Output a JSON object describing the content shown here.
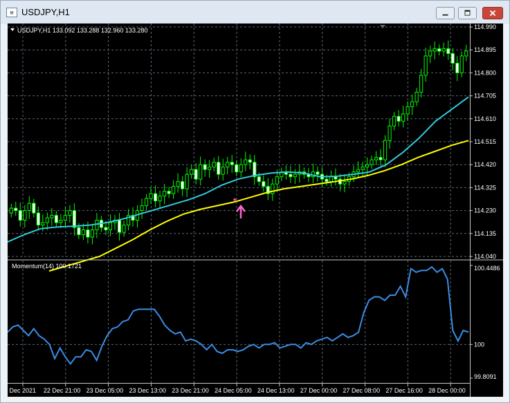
{
  "window": {
    "title": "USDJPY,H1",
    "icon": "chart-window-icon"
  },
  "window_controls": {
    "minimize_icon": "minimize-icon",
    "maximize_icon": "restore-icon",
    "close_icon": "close-icon"
  },
  "price_panel": {
    "header": "USDJPY,H1  133.092 133.288 132.960 133.280",
    "y_ticks": [
      "114.990",
      "114.895",
      "114.800",
      "114.705",
      "114.610",
      "114.515",
      "114.420",
      "114.325",
      "114.230",
      "114.135",
      "114.040"
    ]
  },
  "momentum_panel": {
    "header": "Momentum(14) 100.1721",
    "y_ticks": [
      "100.4486",
      "100",
      "99.8091"
    ]
  },
  "x_ticks": [
    "22 Dec 2021",
    "22 Dec 21:00",
    "23 Dec 05:00",
    "23 Dec 13:00",
    "23 Dec 21:00",
    "24 Dec 05:00",
    "24 Dec 13:00",
    "27 Dec 00:00",
    "27 Dec 08:00",
    "27 Dec 16:00",
    "28 Dec 00:00"
  ],
  "colors": {
    "background": "#000000",
    "bull_candle": "#00ff00",
    "bear_candle": "#ffffff",
    "ma_fast": "#33ccdd",
    "ma_slow": "#ffff00",
    "momentum": "#3a8ee6",
    "grid": "#5a6a7a",
    "signal": "#ff66cc"
  },
  "chart_data": [
    {
      "type": "line",
      "title": "USDJPY,H1",
      "ylim": [
        114.04,
        114.99
      ],
      "x_ticks": [
        "22 Dec 2021",
        "22 Dec 21:00",
        "23 Dec 05:00",
        "23 Dec 13:00",
        "23 Dec 21:00",
        "24 Dec 05:00",
        "24 Dec 13:00",
        "27 Dec 00:00",
        "27 Dec 08:00",
        "27 Dec 16:00",
        "28 Dec 00:00"
      ],
      "close": [
        114.24,
        114.23,
        114.19,
        114.23,
        114.26,
        114.22,
        114.17,
        114.18,
        114.2,
        114.21,
        114.18,
        114.19,
        114.21,
        114.23,
        114.16,
        114.13,
        114.15,
        114.12,
        114.15,
        114.19,
        114.16,
        114.15,
        114.18,
        114.19,
        114.14,
        114.17,
        114.21,
        114.19,
        114.23,
        114.25,
        114.28,
        114.3,
        114.27,
        114.29,
        114.31,
        114.3,
        114.33,
        114.35,
        114.32,
        114.38,
        114.4,
        114.36,
        114.42,
        114.4,
        114.41,
        114.43,
        114.38,
        114.41,
        114.43,
        114.42,
        114.39,
        114.42,
        114.44,
        114.43,
        114.37,
        114.35,
        114.33,
        114.3,
        114.34,
        114.37,
        114.39,
        114.38,
        114.37,
        114.38,
        114.39,
        114.38,
        114.37,
        114.39,
        114.38,
        114.36,
        114.35,
        114.37,
        114.36,
        114.34,
        114.35,
        114.37,
        114.39,
        114.4,
        114.41,
        114.42,
        114.44,
        114.45,
        114.44,
        114.52,
        114.58,
        114.62,
        114.6,
        114.63,
        114.66,
        114.68,
        114.72,
        114.79,
        114.87,
        114.89,
        114.9,
        114.89,
        114.9,
        114.88,
        114.84,
        114.8,
        114.87,
        114.89
      ],
      "series": [
        {
          "values": [
            114.1,
            114.13,
            114.155,
            114.162,
            114.165,
            114.17,
            114.18,
            114.195,
            114.215,
            114.235,
            114.255,
            114.275,
            114.3,
            114.335,
            114.36,
            114.375,
            114.385,
            114.39,
            114.385,
            114.37,
            114.372,
            114.38,
            114.39,
            114.42,
            114.47,
            114.53,
            114.6,
            114.65,
            114.7
          ]
        },
        {
          "values": [
            113.98,
            114.0,
            114.02,
            114.04,
            114.075,
            114.11,
            114.15,
            114.185,
            114.215,
            114.235,
            114.25,
            114.265,
            114.285,
            114.305,
            114.32,
            114.33,
            114.34,
            114.35,
            114.36,
            114.375,
            114.395,
            114.42,
            114.45,
            114.475,
            114.5,
            114.52
          ]
        }
      ]
    },
    {
      "type": "line",
      "title": "Momentum(14) 100.1721",
      "ylim": [
        99.8091,
        100.4486
      ],
      "series": [
        {
          "name": "Momentum(14)",
          "values": [
            100.07,
            100.1,
            100.11,
            100.08,
            100.05,
            100.09,
            100.05,
            100.03,
            100.0,
            99.92,
            99.98,
            99.93,
            99.89,
            99.93,
            99.93,
            99.97,
            99.96,
            99.91,
            99.99,
            100.05,
            100.09,
            100.1,
            100.13,
            100.14,
            100.19,
            100.2,
            100.2,
            100.2,
            100.2,
            100.16,
            100.11,
            100.08,
            100.06,
            100.07,
            100.02,
            100.03,
            100.02,
            100.0,
            99.97,
            100.0,
            99.96,
            99.95,
            99.97,
            99.97,
            99.96,
            99.97,
            99.99,
            100.0,
            99.98,
            100.0,
            100.0,
            100.01,
            99.98,
            99.99,
            100.0,
            100.0,
            99.98,
            100.01,
            100.0,
            100.02,
            100.03,
            100.04,
            100.02,
            100.04,
            100.06,
            100.04,
            100.05,
            100.07,
            100.18,
            100.25,
            100.27,
            100.27,
            100.25,
            100.28,
            100.28,
            100.33,
            100.27,
            100.43,
            100.41,
            100.42,
            100.42,
            100.44,
            100.41,
            100.43,
            100.37,
            100.08,
            100.02,
            100.08,
            100.07
          ]
        }
      ]
    }
  ]
}
